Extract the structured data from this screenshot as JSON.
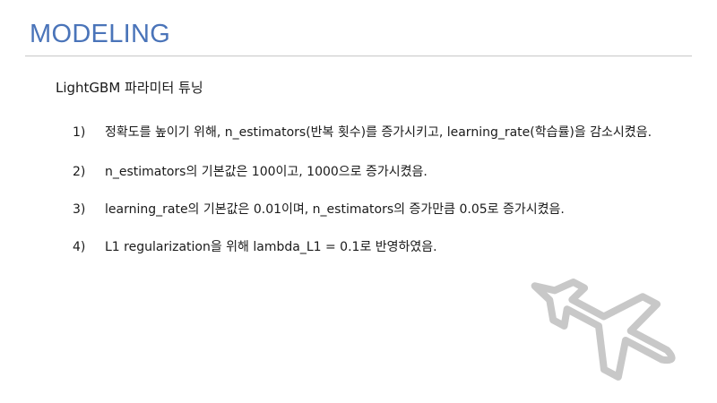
{
  "slide": {
    "title": "MODELING",
    "subtitle": "LightGBM 파라미터 튜닝"
  },
  "items": [
    {
      "number": "1)",
      "text": "정확도를 높이기 위해, n_estimators(반복 횟수)를 증가시키고, learning_rate(학습률)을 감소시켰음."
    },
    {
      "number": "2)",
      "text": "n_estimators의 기본값은 100이고, 1000으로 증가시켰음."
    },
    {
      "number": "3)",
      "text": "learning_rate의 기본값은 0.01이며, n_estimators의 증가만큼 0.05로 증가시켰음."
    },
    {
      "number": "4)",
      "text": "L1 regularization을 위해 lambda_L1 = 0.1로 반영하였음."
    }
  ],
  "decoration": {
    "icon": "airplane-icon",
    "color": "#c8c8c8"
  },
  "colors": {
    "title": "#4a74b9",
    "rule": "#c8c8c8",
    "text": "#1a1a1a"
  }
}
